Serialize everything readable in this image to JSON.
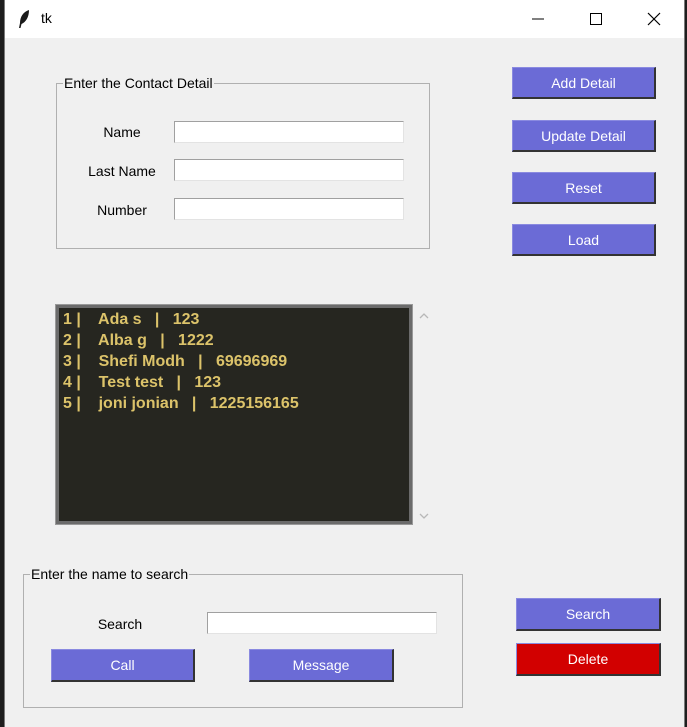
{
  "window": {
    "title": "tk"
  },
  "contact_group": {
    "legend": "Enter the Contact Detail",
    "name_label": "Name",
    "last_name_label": "Last Name",
    "number_label": "Number",
    "name_value": "",
    "last_name_value": "",
    "number_value": ""
  },
  "actions": {
    "add": "Add Detail",
    "update": "Update Detail",
    "reset": "Reset",
    "load": "Load"
  },
  "contacts": [
    "1 |    Ada s   |   123",
    "2 |    Alba g   |   1222",
    "3 |    Shefi Modh   |   69696969",
    "4 |    Test test   |   123",
    "5 |    joni jonian   |   1225156165"
  ],
  "search_group": {
    "legend": "Enter the name to search",
    "search_label": "Search",
    "search_value": "",
    "call": "Call",
    "message": "Message"
  },
  "side_actions": {
    "search": "Search",
    "delete": "Delete"
  },
  "colors": {
    "button": "#6b6bd6",
    "delete_button": "#d20000",
    "list_bg": "#262620",
    "list_text": "#dcc36a"
  }
}
